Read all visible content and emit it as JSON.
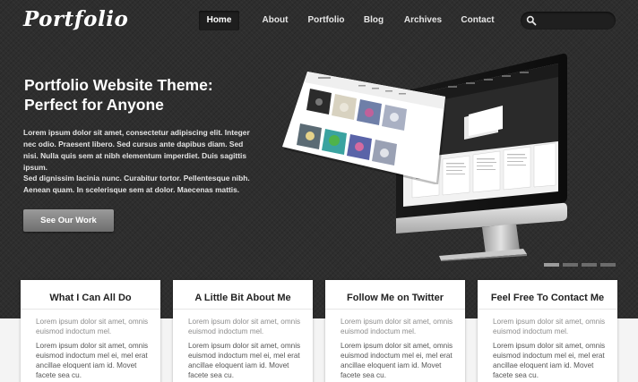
{
  "header": {
    "logo": "Portfolio",
    "nav": [
      "Home",
      "About",
      "Portfolio",
      "Blog",
      "Archives",
      "Contact"
    ],
    "active_nav": "Home",
    "search_placeholder": ""
  },
  "hero": {
    "title_line1": "Portfolio Website Theme:",
    "title_line2": "Perfect for Anyone",
    "paragraph1": "Lorem ipsum dolor sit amet, consectetur adipiscing elit. Integer nec odio. Praesent libero. Sed cursus ante dapibus diam. Sed nisi. Nulla quis sem at nibh elementum imperdiet. Duis sagittis ipsum.",
    "paragraph2": "Sed dignissim lacinia nunc. Curabitur tortor. Pellentesque nibh. Aenean quam. In scelerisque sem at dolor. Maecenas mattis.",
    "cta_label": "See Our Work",
    "slider_count": 4,
    "slider_active": 1
  },
  "boxes": [
    {
      "title": "What I Can All Do",
      "text1": "Lorem ipsum dolor sit amet, omnis euismod indoctum mel.",
      "text2": "Lorem ipsum dolor sit amet, omnis euismod indoctum mel ei, mel erat ancillae eloquent iam id. Movet facete sea cu."
    },
    {
      "title": "A Little Bit About Me",
      "text1": "Lorem ipsum dolor sit amet, omnis euismod indoctum mel.",
      "text2": "Lorem ipsum dolor sit amet, omnis euismod indoctum mel ei, mel erat ancillae eloquent iam id. Movet facete sea cu."
    },
    {
      "title": "Follow Me on Twitter",
      "text1": "Lorem ipsum dolor sit amet, omnis euismod indoctum mel.",
      "text2": "Lorem ipsum dolor sit amet, omnis euismod indoctum mel ei, mel erat ancillae eloquent iam id. Movet facete sea cu."
    },
    {
      "title": "Feel Free To Contact Me",
      "text1": "Lorem ipsum dolor sit amet, omnis euismod indoctum mel.",
      "text2": "Lorem ipsum dolor sit amet, omnis euismod indoctum mel ei, mel erat ancillae eloquent iam id. Movet facete sea cu."
    }
  ],
  "colors": {
    "hero_background": "#2e2e2e",
    "box_background": "#ffffff",
    "accent_button": "#808080"
  },
  "icons": [
    "search-icon"
  ]
}
